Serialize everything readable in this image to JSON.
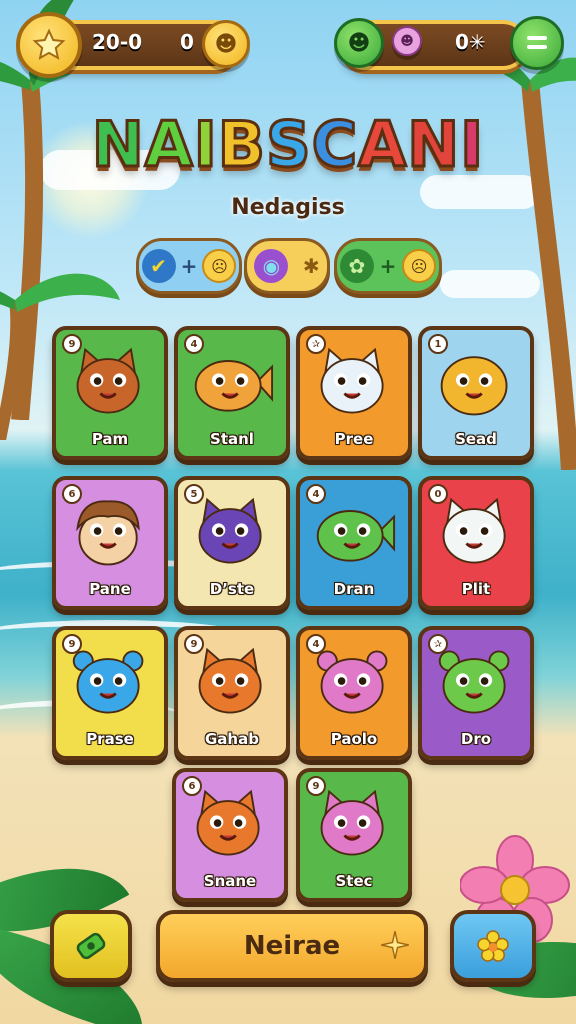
{
  "hud": {
    "score": "20-0",
    "coins": "0",
    "right_value": "0✳"
  },
  "title_letters": [
    "N",
    "A",
    "I",
    "B",
    "S",
    "C",
    "A",
    "N",
    "I"
  ],
  "title_colors": [
    "#3fbf4f",
    "#5fcf3f",
    "#8fd23a",
    "#f1c12b",
    "#3aa7e8",
    "#3a8fe0",
    "#e8483b",
    "#e0443b",
    "#d83a6a"
  ],
  "subtitle": "Nedagiss",
  "powerups": [
    {
      "name": "check",
      "symbol": "+",
      "color": "#7cc6ee"
    },
    {
      "name": "orb",
      "symbol": "✱",
      "color": "#f3c04a"
    },
    {
      "name": "leaf",
      "symbol": "+",
      "color": "#4fbf4f"
    }
  ],
  "cards": [
    {
      "label": "Pam",
      "badge": "9",
      "bg": "#58b94a",
      "creature": "#c8652a",
      "type": "cat"
    },
    {
      "label": "Stanl",
      "badge": "4",
      "bg": "#58b94a",
      "creature": "#f0a33a",
      "type": "fish"
    },
    {
      "label": "Pree",
      "badge": "✰",
      "bg": "#f39a2c",
      "creature": "#e8f2f8",
      "type": "cat"
    },
    {
      "label": "Sead",
      "badge": "1",
      "bg": "#9fd4ef",
      "creature": "#f2b62e",
      "type": "blob"
    },
    {
      "label": "Pane",
      "badge": "6",
      "bg": "#d58ee0",
      "creature": "#f4d2a5",
      "type": "kid"
    },
    {
      "label": "D’ste",
      "badge": "5",
      "bg": "#f4e6b0",
      "creature": "#6a45b5",
      "type": "cat"
    },
    {
      "label": "Dran",
      "badge": "4",
      "bg": "#3a9fd6",
      "creature": "#5fc24a",
      "type": "fish"
    },
    {
      "label": "Plit",
      "badge": "0",
      "bg": "#e9424b",
      "creature": "#f2f6f4",
      "type": "cat"
    },
    {
      "label": "Prase",
      "badge": "9",
      "bg": "#f2dd4a",
      "creature": "#3aa7e8",
      "type": "bear"
    },
    {
      "label": "Gahab",
      "badge": "9",
      "bg": "#f5d59a",
      "creature": "#e7782c",
      "type": "cat"
    },
    {
      "label": "Paolo",
      "badge": "4",
      "bg": "#f39a2c",
      "creature": "#e07ac8",
      "type": "bear"
    },
    {
      "label": "Dro",
      "badge": "✰",
      "bg": "#9a5bc9",
      "creature": "#6dc94a",
      "type": "bear"
    },
    {
      "label": "Snane",
      "badge": "6",
      "bg": "#d58ee0",
      "creature": "#e7782c",
      "type": "cat"
    },
    {
      "label": "Stec",
      "badge": "9",
      "bg": "#58b94a",
      "creature": "#e07ac8",
      "type": "cat"
    }
  ],
  "bottom": {
    "main_label": "Neirae"
  }
}
